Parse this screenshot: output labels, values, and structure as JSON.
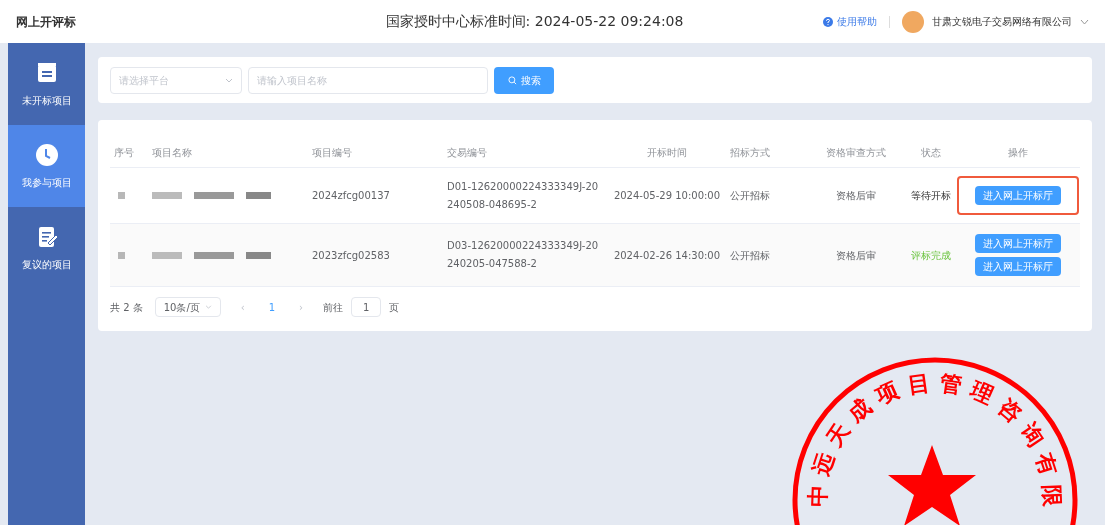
{
  "header": {
    "app_title": "网上开评标",
    "clock": "国家授时中心标准时间: 2024-05-22 09:24:08",
    "help_link": "使用帮助",
    "user_name": "甘肃文锐电子交易网络有限公司"
  },
  "sidebar": {
    "items": [
      {
        "label": "未开标项目",
        "selected": false
      },
      {
        "label": "我参与项目",
        "selected": true
      },
      {
        "label": "复议的项目",
        "selected": false
      }
    ]
  },
  "search": {
    "platform_placeholder": "请选择平台",
    "name_placeholder": "请输入项目名称",
    "button": "搜索"
  },
  "table": {
    "columns": [
      "序号",
      "项目名称",
      "项目编号",
      "交易编号",
      "开标时间",
      "招标方式",
      "资格审查方式",
      "状态",
      "操作"
    ],
    "rows": [
      {
        "project_code": "2024zfcg00137",
        "trade_code": "D01-12620000224333349J-20240508-048695-2",
        "open_time": "2024-05-29 10:00:00",
        "method": "公开招标",
        "review": "资格后审",
        "status": "等待开标",
        "kind": "waiting",
        "actions": [
          "进入网上开标厅"
        ],
        "highlighted": true
      },
      {
        "project_code": "2023zfcg02583",
        "trade_code": "D03-12620000224333349J-20240205-047588-2",
        "open_time": "2024-02-26 14:30:00",
        "method": "公开招标",
        "review": "资格后审",
        "status": "评标完成",
        "kind": "done",
        "actions": [
          "进入网上开标厅",
          "进入网上开标厅"
        ],
        "highlighted": false
      }
    ]
  },
  "pagination": {
    "total": "共 2 条",
    "page_size": "10条/页",
    "prev": "‹",
    "current_page": "1",
    "next": "›",
    "goto_label": "前往",
    "goto_value": "1",
    "goto_suffix": "页"
  },
  "seal": {
    "characters": [
      "中",
      "远",
      "天",
      "成",
      "项",
      "目",
      "管",
      "理",
      "咨",
      "询",
      "有",
      "限"
    ]
  }
}
